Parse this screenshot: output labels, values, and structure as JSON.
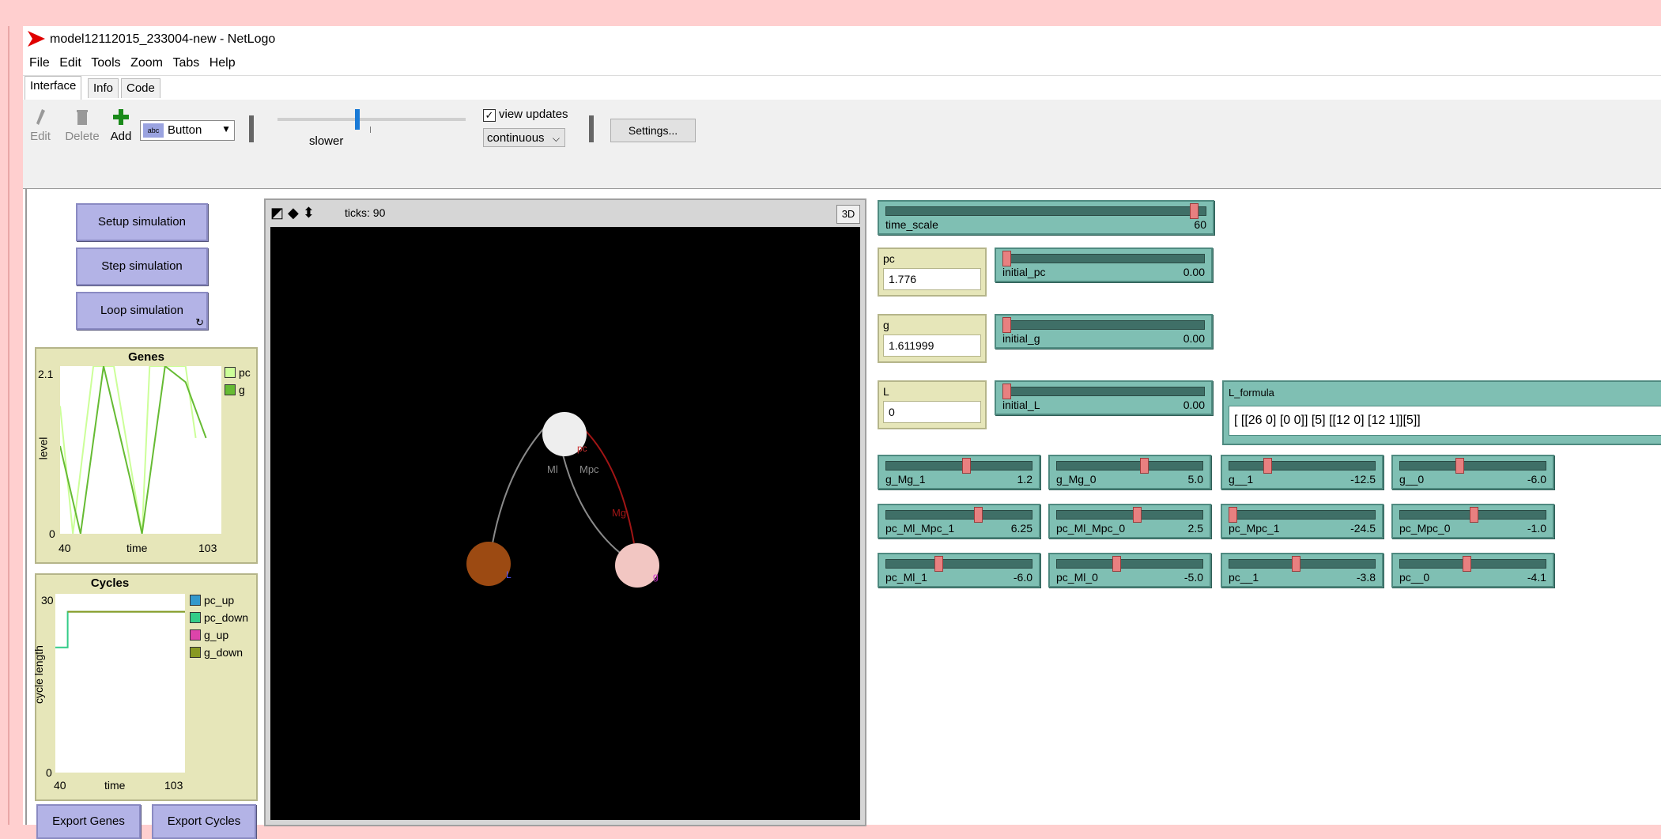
{
  "window": {
    "title": "model12112015_233004-new - NetLogo"
  },
  "menu": [
    "File",
    "Edit",
    "Tools",
    "Zoom",
    "Tabs",
    "Help"
  ],
  "tabs": [
    "Interface",
    "Info",
    "Code"
  ],
  "toolbar": {
    "edit_label": "Edit",
    "delete_label": "Delete",
    "add_label": "Add",
    "widget_type": "Button",
    "speed_label": "slower",
    "view_updates_label": "view updates",
    "view_updates_checked": true,
    "update_mode": "continuous",
    "settings_label": "Settings...",
    "speed_level": 0.41
  },
  "buttons": {
    "setup": "Setup simulation",
    "step": "Step simulation",
    "loop": "Loop simulation",
    "export_genes": "Export Genes",
    "export_cycles": "Export Cycles"
  },
  "view": {
    "ticks_label": "ticks: 90",
    "three_d": "3D",
    "nodes": [
      {
        "id": "pc",
        "label": "pc",
        "color": "#eeeeee"
      },
      {
        "id": "L",
        "label": "L",
        "color": "#9c4a12"
      },
      {
        "id": "g",
        "label": "g",
        "color": "#f2c6c2"
      }
    ],
    "edge_labels": [
      "Ml",
      "Mpc",
      "Mg"
    ]
  },
  "chart_data": [
    {
      "type": "line",
      "title": "Genes",
      "xlabel": "time",
      "ylabel": "level",
      "xlim": [
        40,
        103
      ],
      "ylim": [
        0,
        2.1
      ],
      "x_ticks": [
        "40",
        "103"
      ],
      "y_ticks": [
        "0",
        "2.1"
      ],
      "series": [
        {
          "name": "pc",
          "color": "#ccff99",
          "x": [
            40,
            45,
            53,
            57,
            61,
            72,
            75,
            84,
            89,
            93
          ],
          "y": [
            1.6,
            0,
            2.1,
            2.1,
            2.1,
            0,
            2.1,
            2.1,
            2.1,
            1.2
          ]
        },
        {
          "name": "g",
          "color": "#66bb33",
          "x": [
            40,
            48,
            57,
            68,
            72,
            81,
            89,
            97
          ],
          "y": [
            1.1,
            0,
            2.1,
            0.6,
            0,
            2.1,
            1.9,
            1.2
          ]
        }
      ]
    },
    {
      "type": "line",
      "title": "Cycles",
      "xlabel": "time",
      "ylabel": "cycle length",
      "xlim": [
        40,
        103
      ],
      "ylim": [
        0,
        30
      ],
      "x_ticks": [
        "40",
        "103"
      ],
      "y_ticks": [
        "0",
        "30"
      ],
      "series": [
        {
          "name": "pc_up",
          "color": "#3399cc",
          "x": [],
          "y": []
        },
        {
          "name": "pc_down",
          "color": "#33cc88",
          "x": [
            40,
            46,
            46,
            103
          ],
          "y": [
            21,
            21,
            27,
            27
          ]
        },
        {
          "name": "g_up",
          "color": "#dd44aa",
          "x": [],
          "y": []
        },
        {
          "name": "g_down",
          "color": "#889922",
          "x": [
            46,
            103
          ],
          "y": [
            27,
            27
          ]
        }
      ]
    }
  ],
  "sliders": {
    "time_scale": {
      "label": "time_scale",
      "value": "60",
      "pos": 0.97
    },
    "initial_pc": {
      "label": "initial_pc",
      "value": "0.00",
      "pos": 0.0
    },
    "initial_g": {
      "label": "initial_g",
      "value": "0.00",
      "pos": 0.0
    },
    "initial_L": {
      "label": "initial_L",
      "value": "0.00",
      "pos": 0.0
    },
    "g_Mg_1": {
      "label": "g_Mg_1",
      "value": "1.2",
      "pos": 0.55
    },
    "g_Mg_0": {
      "label": "g_Mg_0",
      "value": "5.0",
      "pos": 0.6
    },
    "g__1": {
      "label": "g__1",
      "value": "-12.5",
      "pos": 0.25
    },
    "g__0": {
      "label": "g__0",
      "value": "-6.0",
      "pos": 0.4
    },
    "pc_Ml_Mpc_1": {
      "label": "pc_Ml_Mpc_1",
      "value": "6.25",
      "pos": 0.63
    },
    "pc_Ml_Mpc_0": {
      "label": "pc_Ml_Mpc_0",
      "value": "2.5",
      "pos": 0.55
    },
    "pc_Mpc_1": {
      "label": "pc_Mpc_1",
      "value": "-24.5",
      "pos": 0.0
    },
    "pc_Mpc_0": {
      "label": "pc_Mpc_0",
      "value": "-1.0",
      "pos": 0.5
    },
    "pc_Ml_1": {
      "label": "pc_Ml_1",
      "value": "-6.0",
      "pos": 0.35
    },
    "pc_Ml_0": {
      "label": "pc_Ml_0",
      "value": "-5.0",
      "pos": 0.4
    },
    "pc__1": {
      "label": "pc__1",
      "value": "-3.8",
      "pos": 0.45
    },
    "pc__0": {
      "label": "pc__0",
      "value": "-4.1",
      "pos": 0.45
    }
  },
  "monitors": {
    "pc": {
      "label": "pc",
      "value": "1.776"
    },
    "g": {
      "label": "g",
      "value": "1.611999"
    },
    "L": {
      "label": "L",
      "value": "0"
    }
  },
  "l_formula": {
    "label": "L_formula",
    "value": "[ [[26 0] [0 0]] [5] [[12 0] [12 1]][5]]"
  }
}
